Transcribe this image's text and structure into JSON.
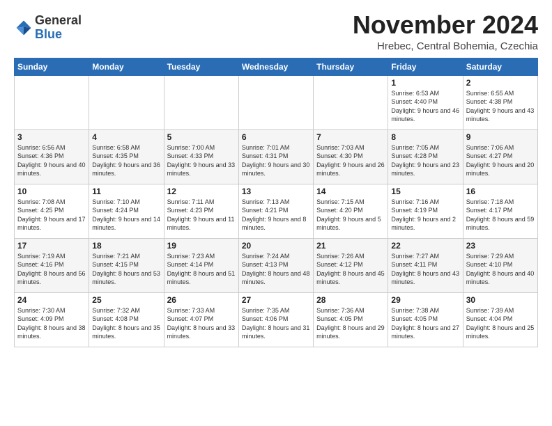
{
  "header": {
    "logo": {
      "general": "General",
      "blue": "Blue"
    },
    "title": "November 2024",
    "location": "Hrebec, Central Bohemia, Czechia"
  },
  "days_of_week": [
    "Sunday",
    "Monday",
    "Tuesday",
    "Wednesday",
    "Thursday",
    "Friday",
    "Saturday"
  ],
  "weeks": [
    [
      {
        "day": "",
        "info": ""
      },
      {
        "day": "",
        "info": ""
      },
      {
        "day": "",
        "info": ""
      },
      {
        "day": "",
        "info": ""
      },
      {
        "day": "",
        "info": ""
      },
      {
        "day": "1",
        "info": "Sunrise: 6:53 AM\nSunset: 4:40 PM\nDaylight: 9 hours\nand 46 minutes."
      },
      {
        "day": "2",
        "info": "Sunrise: 6:55 AM\nSunset: 4:38 PM\nDaylight: 9 hours\nand 43 minutes."
      }
    ],
    [
      {
        "day": "3",
        "info": "Sunrise: 6:56 AM\nSunset: 4:36 PM\nDaylight: 9 hours\nand 40 minutes."
      },
      {
        "day": "4",
        "info": "Sunrise: 6:58 AM\nSunset: 4:35 PM\nDaylight: 9 hours\nand 36 minutes."
      },
      {
        "day": "5",
        "info": "Sunrise: 7:00 AM\nSunset: 4:33 PM\nDaylight: 9 hours\nand 33 minutes."
      },
      {
        "day": "6",
        "info": "Sunrise: 7:01 AM\nSunset: 4:31 PM\nDaylight: 9 hours\nand 30 minutes."
      },
      {
        "day": "7",
        "info": "Sunrise: 7:03 AM\nSunset: 4:30 PM\nDaylight: 9 hours\nand 26 minutes."
      },
      {
        "day": "8",
        "info": "Sunrise: 7:05 AM\nSunset: 4:28 PM\nDaylight: 9 hours\nand 23 minutes."
      },
      {
        "day": "9",
        "info": "Sunrise: 7:06 AM\nSunset: 4:27 PM\nDaylight: 9 hours\nand 20 minutes."
      }
    ],
    [
      {
        "day": "10",
        "info": "Sunrise: 7:08 AM\nSunset: 4:25 PM\nDaylight: 9 hours\nand 17 minutes."
      },
      {
        "day": "11",
        "info": "Sunrise: 7:10 AM\nSunset: 4:24 PM\nDaylight: 9 hours\nand 14 minutes."
      },
      {
        "day": "12",
        "info": "Sunrise: 7:11 AM\nSunset: 4:23 PM\nDaylight: 9 hours\nand 11 minutes."
      },
      {
        "day": "13",
        "info": "Sunrise: 7:13 AM\nSunset: 4:21 PM\nDaylight: 9 hours\nand 8 minutes."
      },
      {
        "day": "14",
        "info": "Sunrise: 7:15 AM\nSunset: 4:20 PM\nDaylight: 9 hours\nand 5 minutes."
      },
      {
        "day": "15",
        "info": "Sunrise: 7:16 AM\nSunset: 4:19 PM\nDaylight: 9 hours\nand 2 minutes."
      },
      {
        "day": "16",
        "info": "Sunrise: 7:18 AM\nSunset: 4:17 PM\nDaylight: 8 hours\nand 59 minutes."
      }
    ],
    [
      {
        "day": "17",
        "info": "Sunrise: 7:19 AM\nSunset: 4:16 PM\nDaylight: 8 hours\nand 56 minutes."
      },
      {
        "day": "18",
        "info": "Sunrise: 7:21 AM\nSunset: 4:15 PM\nDaylight: 8 hours\nand 53 minutes."
      },
      {
        "day": "19",
        "info": "Sunrise: 7:23 AM\nSunset: 4:14 PM\nDaylight: 8 hours\nand 51 minutes."
      },
      {
        "day": "20",
        "info": "Sunrise: 7:24 AM\nSunset: 4:13 PM\nDaylight: 8 hours\nand 48 minutes."
      },
      {
        "day": "21",
        "info": "Sunrise: 7:26 AM\nSunset: 4:12 PM\nDaylight: 8 hours\nand 45 minutes."
      },
      {
        "day": "22",
        "info": "Sunrise: 7:27 AM\nSunset: 4:11 PM\nDaylight: 8 hours\nand 43 minutes."
      },
      {
        "day": "23",
        "info": "Sunrise: 7:29 AM\nSunset: 4:10 PM\nDaylight: 8 hours\nand 40 minutes."
      }
    ],
    [
      {
        "day": "24",
        "info": "Sunrise: 7:30 AM\nSunset: 4:09 PM\nDaylight: 8 hours\nand 38 minutes."
      },
      {
        "day": "25",
        "info": "Sunrise: 7:32 AM\nSunset: 4:08 PM\nDaylight: 8 hours\nand 35 minutes."
      },
      {
        "day": "26",
        "info": "Sunrise: 7:33 AM\nSunset: 4:07 PM\nDaylight: 8 hours\nand 33 minutes."
      },
      {
        "day": "27",
        "info": "Sunrise: 7:35 AM\nSunset: 4:06 PM\nDaylight: 8 hours\nand 31 minutes."
      },
      {
        "day": "28",
        "info": "Sunrise: 7:36 AM\nSunset: 4:05 PM\nDaylight: 8 hours\nand 29 minutes."
      },
      {
        "day": "29",
        "info": "Sunrise: 7:38 AM\nSunset: 4:05 PM\nDaylight: 8 hours\nand 27 minutes."
      },
      {
        "day": "30",
        "info": "Sunrise: 7:39 AM\nSunset: 4:04 PM\nDaylight: 8 hours\nand 25 minutes."
      }
    ]
  ]
}
